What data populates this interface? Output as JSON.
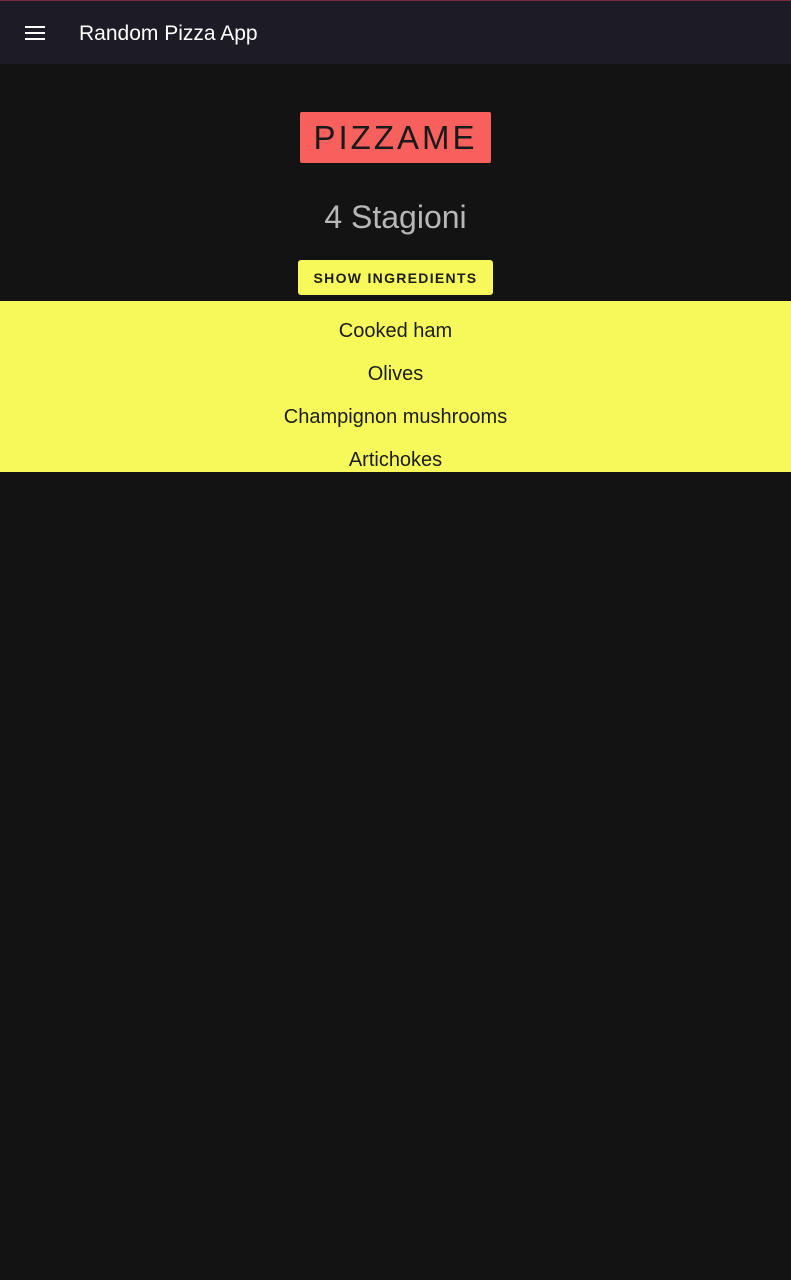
{
  "app_bar": {
    "title": "Random Pizza App",
    "menu_icon": "hamburger-menu-icon",
    "background": "#1d1b25"
  },
  "logo": {
    "text": "PIZZAME",
    "background": "#f8605e"
  },
  "pizza": {
    "name": "4 Stagioni"
  },
  "show_button": {
    "label": "SHOW INGREDIENTS",
    "background": "#f7f95a"
  },
  "ingredients": {
    "background": "#f7f95a",
    "items": [
      "Cooked ham",
      "Olives",
      "Champignon mushrooms",
      "Artichokes"
    ]
  },
  "page_background": "#131313"
}
